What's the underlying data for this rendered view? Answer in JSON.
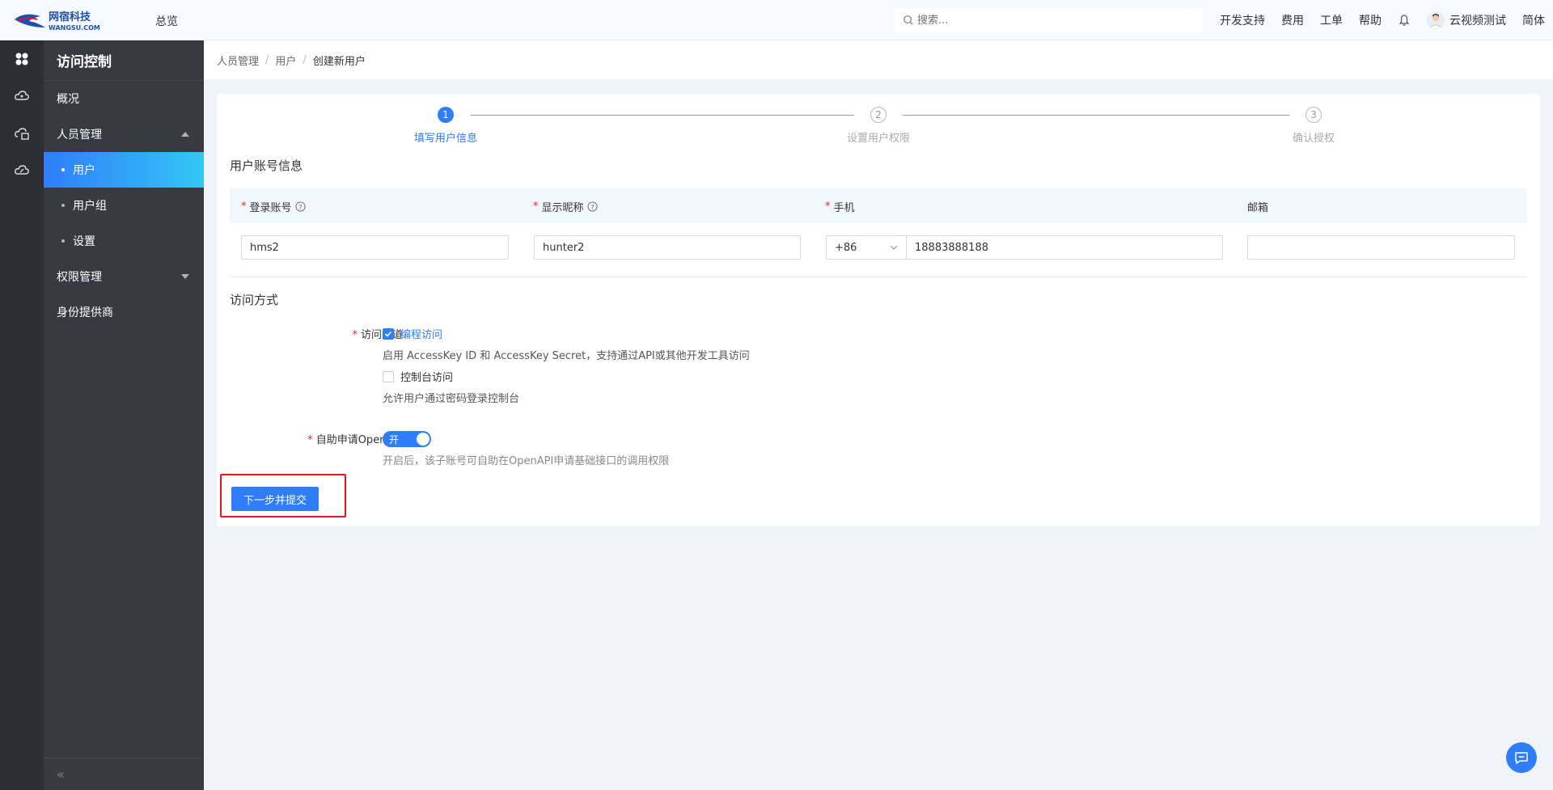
{
  "topbar": {
    "logo_cn": "网宿科技",
    "logo_en": "WANGSU.COM",
    "overview": "总览",
    "search_placeholder": "搜索...",
    "links": [
      "开发支持",
      "费用",
      "工单",
      "帮助"
    ],
    "user_name": "云视频测试",
    "language": "简体"
  },
  "rail": {
    "icons": [
      "apps-icon",
      "cloud-icon",
      "cloud-storage-icon",
      "cloud-link-icon"
    ]
  },
  "sidebar": {
    "title": "访问控制",
    "items": [
      {
        "label": "概况"
      },
      {
        "label": "人员管理"
      },
      {
        "label": "用户"
      },
      {
        "label": "用户组"
      },
      {
        "label": "设置"
      },
      {
        "label": "权限管理"
      },
      {
        "label": "身份提供商"
      }
    ],
    "collapse": "«"
  },
  "breadcrumb": {
    "items": [
      "人员管理",
      "用户",
      "创建新用户"
    ],
    "separator": "/"
  },
  "steps": [
    {
      "num": "1",
      "label": "填写用户信息"
    },
    {
      "num": "2",
      "label": "设置用户权限"
    },
    {
      "num": "3",
      "label": "确认授权"
    }
  ],
  "account_info": {
    "title": "用户账号信息",
    "columns": [
      "登录账号",
      "显示昵称",
      "手机",
      "邮箱"
    ],
    "login_value": "hms2",
    "nickname_value": "hunter2",
    "phone_code": "+86",
    "phone_value": "18883888188",
    "email_value": ""
  },
  "access": {
    "title": "访问方式",
    "channel_label": "访问渠道",
    "programmatic_label": "编程访问",
    "programmatic_desc": "启用 AccessKey ID 和 AccessKey Secret，支持通过API或其他开发工具访问",
    "console_label": "控制台访问",
    "console_desc": "允许用户通过密码登录控制台",
    "openapi_label": "自助申请OpenAPI",
    "toggle_text": "开",
    "openapi_desc": "开启后，该子账号可自助在OpenAPI申请基础接口的调用权限"
  },
  "actions": {
    "submit": "下一步并提交"
  },
  "colors": {
    "primary": "#2f7dfb",
    "required": "#f5222d",
    "highlight_box": "#e8141c"
  }
}
